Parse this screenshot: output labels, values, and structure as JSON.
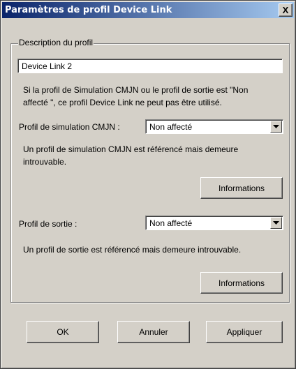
{
  "window": {
    "title": "Paramètres de profil Device Link",
    "close_label": "X"
  },
  "group": {
    "legend": "Description du profil",
    "description_value": "Device Link 2",
    "info_line1": "Si la profil de Simulation CMJN ou le profil de sortie est \"Non",
    "info_line2": "affecté \", ce profil Device Link ne peut pas être utilisé."
  },
  "simulation": {
    "label": "Profil de simulation CMJN :",
    "selected": "Non affecté",
    "msg_line1": "Un profil de simulation CMJN est référencé mais demeure",
    "msg_line2": "introuvable.",
    "info_button": "Informations"
  },
  "output": {
    "label": "Profil de sortie :",
    "selected": "Non affecté",
    "msg": "Un profil de sortie est référencé mais demeure introuvable.",
    "info_button": "Informations"
  },
  "footer": {
    "ok": "OK",
    "cancel": "Annuler",
    "apply": "Appliquer"
  },
  "icons": {
    "close": "close-icon",
    "dropdown": "chevron-down-icon"
  }
}
